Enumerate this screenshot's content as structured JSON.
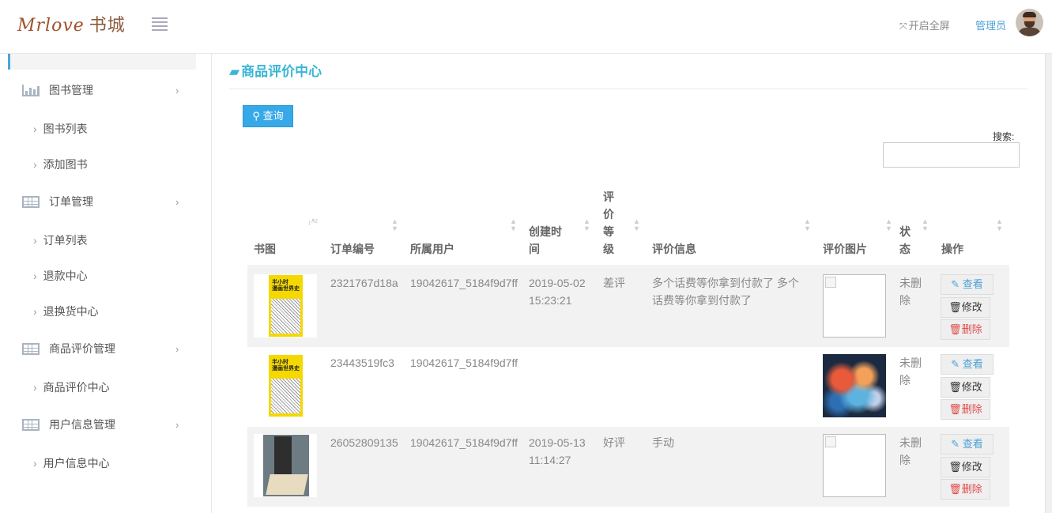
{
  "header": {
    "logo_en": "Mrlove",
    "logo_cn": "书城",
    "fullscreen_label": "开启全屏",
    "admin_label": "管理员"
  },
  "sidebar": {
    "groups": [
      {
        "label": "图书管理",
        "icon": "bar-chart-icon"
      },
      {
        "label": "订单管理",
        "icon": "table-icon"
      },
      {
        "label": "商品评价管理",
        "icon": "table-icon"
      },
      {
        "label": "用户信息管理",
        "icon": "table-icon"
      }
    ],
    "items": [
      {
        "label": "图书列表"
      },
      {
        "label": "添加图书"
      },
      {
        "label": "订单列表"
      },
      {
        "label": "退款中心"
      },
      {
        "label": "退换货中心"
      },
      {
        "label": "商品评价中心"
      },
      {
        "label": "用户信息中心"
      }
    ]
  },
  "main": {
    "title": "商品评价中心",
    "query_label": "查询",
    "search_label": "搜索:",
    "search_value": ""
  },
  "table": {
    "headers": {
      "cover": "书图",
      "order_no": "订单编号",
      "user": "所属用户",
      "created": "创建时间",
      "rating": "评价等级",
      "comment": "评价信息",
      "image": "评价图片",
      "status": "状态",
      "actions": "操作"
    },
    "action_labels": {
      "view": "查看",
      "edit": "修改",
      "delete": "删除"
    },
    "rows": [
      {
        "order_no": "2321767d18a",
        "user": "19042617_5184f9d7ff",
        "created_date": "2019-05-02",
        "created_time": "15:23:21",
        "rating": "差评",
        "comment": "多个话费等你拿到付款了 多个话费等你拿到付款了",
        "status": "未删除"
      },
      {
        "order_no": "23443519fc3",
        "user": "19042617_5184f9d7ff",
        "created_date": "",
        "created_time": "",
        "rating": "",
        "comment": "",
        "status": "未删除"
      },
      {
        "order_no": "26052809135",
        "user": "19042617_5184f9d7ff",
        "created_date": "2019-05-13",
        "created_time": "11:14:27",
        "rating": "好评",
        "comment": "手动",
        "status": "未删除"
      }
    ]
  },
  "colors": {
    "accent": "#3ab5d6",
    "button_blue": "#38a9e8",
    "delete_red": "#e04b4b"
  }
}
